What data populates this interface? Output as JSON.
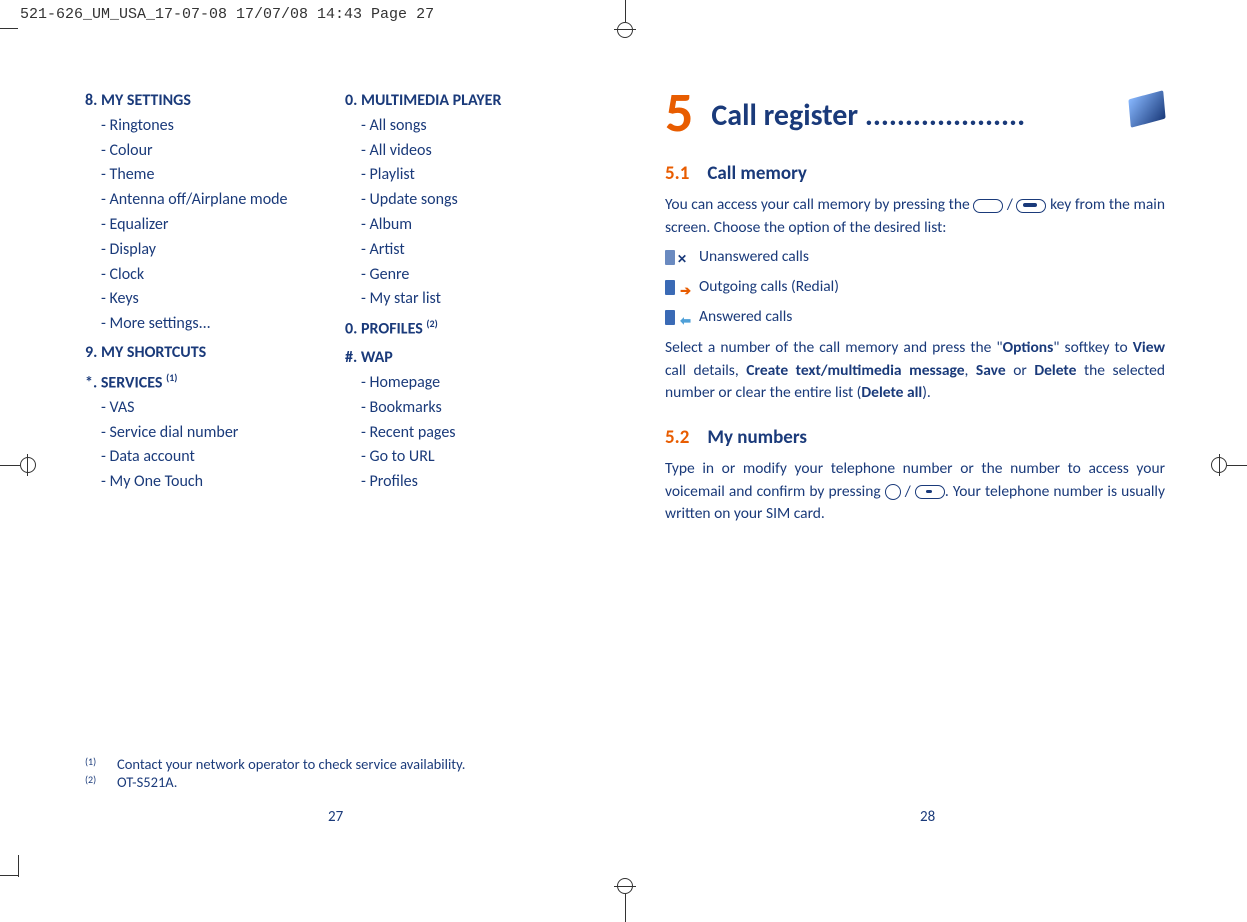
{
  "print_header": "521-626_UM_USA_17-07-08  17/07/08  14:43  Page 27",
  "left": {
    "col1": {
      "sec8": {
        "title": "8. MY SETTINGS",
        "items": [
          "Ringtones",
          "Colour",
          "Theme",
          "Antenna off/Airplane mode",
          "Equalizer",
          "Display",
          "Clock",
          "Keys",
          "More settings..."
        ]
      },
      "sec9": {
        "title": "9. MY SHORTCUTS"
      },
      "secStar": {
        "title": "*.  SERVICES",
        "sup": "(1)",
        "items": [
          "VAS",
          "Service dial number",
          "Data account",
          "My One Touch"
        ]
      }
    },
    "col2": {
      "sec0a": {
        "title": "0. MULTIMEDIA PLAYER",
        "items": [
          "All songs",
          "All videos",
          "Playlist",
          "Update songs",
          "Album",
          "Artist",
          "Genre",
          "My star list"
        ]
      },
      "sec0b": {
        "title": "0. PROFILES",
        "sup": "(2)"
      },
      "secHash": {
        "title": "#. WAP",
        "items": [
          "Homepage",
          "Bookmarks",
          "Recent pages",
          "Go to URL",
          "Profiles"
        ]
      }
    },
    "footnotes": {
      "f1": {
        "sup": "(1)",
        "text": "Contact your network operator to check service availability."
      },
      "f2": {
        "sup": "(2)",
        "text": "OT-S521A."
      }
    },
    "page_num": "27"
  },
  "right": {
    "chapter_num": "5",
    "chapter_title": "Call register ....................",
    "s51": {
      "num": "5.1",
      "title": "Call memory",
      "intro_a": "You can access your call memory by pressing the ",
      "intro_b": " key from the main screen. Choose the option of the desired list:",
      "rows": {
        "unanswered": "Unanswered calls",
        "outgoing": "Outgoing calls (Redial)",
        "answered": "Answered calls"
      },
      "para2_a": "Select a number of the call memory and press the \"",
      "para2_b": "\" softkey to ",
      "para2_c": " call details, ",
      "para2_d": ", ",
      "para2_e": " or ",
      "para2_f": " the selected number or clear the entire list (",
      "para2_g": ").",
      "bold": {
        "options": "Options",
        "view": "View",
        "create": "Create text/multimedia message",
        "save": "Save",
        "delete": "Delete",
        "deleteall": "Delete all"
      }
    },
    "s52": {
      "num": "5.2",
      "title": "My numbers",
      "para_a": "Type in or modify your telephone number or the number to access your voicemail and confirm by pressing ",
      "para_b": ". Your telephone number is usually written on your SIM card."
    },
    "page_num": "28"
  }
}
